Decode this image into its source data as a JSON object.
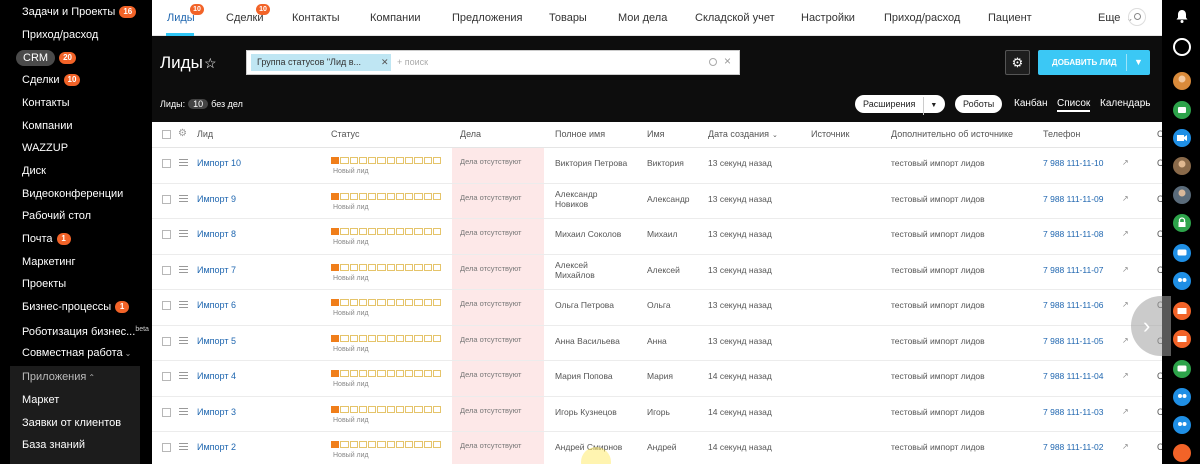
{
  "sidebar": {
    "items": [
      {
        "label": "Задачи и Проекты",
        "badge": "16"
      },
      {
        "label": "Приход/расход",
        "badge": ""
      },
      {
        "label": "CRM",
        "badge": "20"
      },
      {
        "label": "Сделки",
        "badge": "10"
      },
      {
        "label": "Контакты",
        "badge": ""
      },
      {
        "label": "Компании",
        "badge": ""
      },
      {
        "label": "WAZZUP",
        "badge": ""
      },
      {
        "label": "Диск",
        "badge": ""
      },
      {
        "label": "Видеоконференции",
        "badge": ""
      },
      {
        "label": "Рабочий стол",
        "badge": ""
      },
      {
        "label": "Почта",
        "badge": "1"
      },
      {
        "label": "Маркетинг",
        "badge": ""
      },
      {
        "label": "Проекты",
        "badge": ""
      },
      {
        "label": "Бизнес-процессы",
        "badge": "1"
      },
      {
        "label": "Роботизация бизнес...",
        "badge": ""
      },
      {
        "label": "Совместная работа",
        "badge": ""
      }
    ],
    "beta": "beta",
    "apps_label": "Приложения",
    "apps_items": [
      "Маркет",
      "Заявки от клиентов",
      "База знаний"
    ]
  },
  "topnav": {
    "tabs": [
      {
        "label": "Лиды",
        "badge": "10"
      },
      {
        "label": "Сделки",
        "badge": "10"
      },
      {
        "label": "Контакты",
        "badge": ""
      },
      {
        "label": "Компании",
        "badge": ""
      },
      {
        "label": "Предложения",
        "badge": ""
      },
      {
        "label": "Товары",
        "badge": ""
      },
      {
        "label": "Мои дела",
        "badge": ""
      },
      {
        "label": "Складской учет",
        "badge": ""
      },
      {
        "label": "Настройки",
        "badge": ""
      },
      {
        "label": "Приход/расход",
        "badge": ""
      },
      {
        "label": "Пациент",
        "badge": ""
      }
    ],
    "more": "Еще"
  },
  "header": {
    "title": "Лиды",
    "filter_chip": "Группа статусов \"Лид в...",
    "search_placeholder": "+ поиск",
    "add_button": "ДОБАВИТЬ ЛИД",
    "counter_label": "Лиды:",
    "counter_value": "10",
    "counter_suffix": "без дел",
    "extensions": "Расширения",
    "robots": "Роботы",
    "views": [
      "Канбан",
      "Список",
      "Календарь"
    ]
  },
  "grid": {
    "columns": [
      "Лид",
      "Статус",
      "Дела",
      "Полное имя",
      "Имя",
      "Дата создания",
      "Источник",
      "Дополнительно об источнике",
      "Телефон"
    ],
    "rows": [
      {
        "name": "Импорт 10",
        "status": "Новый лид",
        "deals": "Дела отсутствуют",
        "full1": "Виктория Петрова",
        "full2": "",
        "first": "Виктория",
        "created": "13 секунд назад",
        "extra": "тестовый импорт лидов",
        "phone": "7 988 111-11-10"
      },
      {
        "name": "Импорт 9",
        "status": "Новый лид",
        "deals": "Дела отсутствуют",
        "full1": "Александр",
        "full2": "Новиков",
        "first": "Александр",
        "created": "13 секунд назад",
        "extra": "тестовый импорт лидов",
        "phone": "7 988 111-11-09"
      },
      {
        "name": "Импорт 8",
        "status": "Новый лид",
        "deals": "Дела отсутствуют",
        "full1": "Михаил Соколов",
        "full2": "",
        "first": "Михаил",
        "created": "13 секунд назад",
        "extra": "тестовый импорт лидов",
        "phone": "7 988 111-11-08"
      },
      {
        "name": "Импорт 7",
        "status": "Новый лид",
        "deals": "Дела отсутствуют",
        "full1": "Алексей",
        "full2": "Михайлов",
        "first": "Алексей",
        "created": "13 секунд назад",
        "extra": "тестовый импорт лидов",
        "phone": "7 988 111-11-07"
      },
      {
        "name": "Импорт 6",
        "status": "Новый лид",
        "deals": "Дела отсутствуют",
        "full1": "Ольга Петрова",
        "full2": "",
        "first": "Ольга",
        "created": "13 секунд назад",
        "extra": "тестовый импорт лидов",
        "phone": "7 988 111-11-06"
      },
      {
        "name": "Импорт 5",
        "status": "Новый лид",
        "deals": "Дела отсутствуют",
        "full1": "Анна Васильева",
        "full2": "",
        "first": "Анна",
        "created": "13 секунд назад",
        "extra": "тестовый импорт лидов",
        "phone": "7 988 111-11-05"
      },
      {
        "name": "Импорт 4",
        "status": "Новый лид",
        "deals": "Дела отсутствуют",
        "full1": "Мария Попова",
        "full2": "",
        "first": "Мария",
        "created": "14 секунд назад",
        "extra": "тестовый импорт лидов",
        "phone": "7 988 111-11-04"
      },
      {
        "name": "Импорт 3",
        "status": "Новый лид",
        "deals": "Дела отсутствуют",
        "full1": "Игорь Кузнецов",
        "full2": "",
        "first": "Игорь",
        "created": "14 секунд назад",
        "extra": "тестовый импорт лидов",
        "phone": "7 988 111-11-03"
      },
      {
        "name": "Импорт 2",
        "status": "Новый лид",
        "deals": "Дела отсутствуют",
        "full1": "Андрей Смирнов",
        "full2": "",
        "first": "Андрей",
        "created": "14 секунд назад",
        "extra": "тестовый импорт лидов",
        "phone": "7 988 111-11-02"
      }
    ],
    "status_filled_segments": 1,
    "status_total_segments": 12,
    "edge_fragment": "C"
  },
  "colors": {
    "accent": "#2fc6f6",
    "link": "#2067b0",
    "badge": "#f26328",
    "status_fill": "#f07e1a",
    "deals_bg": "#fde8e8"
  },
  "icons": [
    "star-icon",
    "gear-icon",
    "search-icon",
    "close-icon",
    "phone-icon",
    "drag-handle-icon",
    "bell-icon",
    "chevron-right-icon"
  ]
}
